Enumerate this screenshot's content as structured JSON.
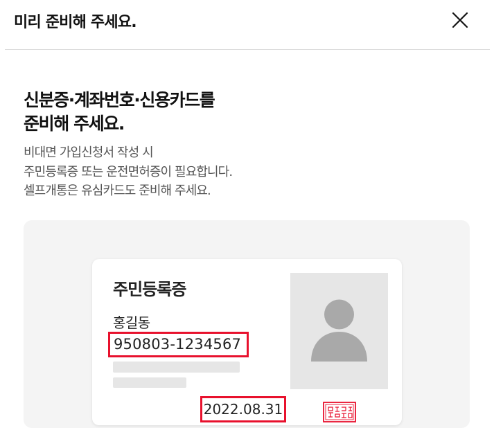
{
  "header": {
    "title": "미리 준비해 주세요.",
    "close_icon": "close-icon"
  },
  "headline": {
    "line1": "신분증·계좌번호·신용카드를",
    "line2": "준비해 주세요."
  },
  "description": {
    "line1": "비대면 가입신청서 작성 시",
    "line2": "주민등록증 또는 운전면허증이 필요합니다.",
    "line3": "셀프개통은 유심카드도 준비해 주세요."
  },
  "id_card": {
    "title": "주민등록증",
    "name": "홍길동",
    "resident_number": "950803-1234567",
    "issue_date": "2022.08.31",
    "photo_icon": "person-silhouette-icon",
    "seal_icon": "official-seal-icon"
  },
  "colors": {
    "highlight_border": "#e8112d",
    "illustration_bg": "#f4f4f4",
    "placeholder_gray": "#e6e6e6",
    "silhouette_gray": "#a9a9a9",
    "description_text": "#555555"
  }
}
